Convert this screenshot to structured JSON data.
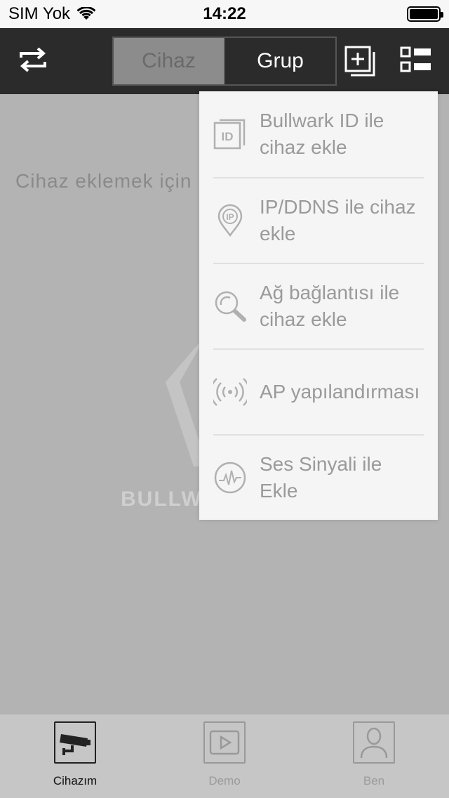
{
  "status_bar": {
    "carrier": "SIM Yok",
    "time": "14:22"
  },
  "nav": {
    "segments": [
      "Cihaz",
      "Grup"
    ],
    "selected": "Grup"
  },
  "main": {
    "hint_text": "Cihaz eklemek için",
    "logo_text": "BULLWARK"
  },
  "dropdown": {
    "items": [
      {
        "label": "Bullwark ID ile cihaz ekle",
        "icon": "id-card-icon"
      },
      {
        "label": "IP/DDNS ile cihaz ekle",
        "icon": "ip-pin-icon"
      },
      {
        "label": "Ağ bağlantısı ile cihaz ekle",
        "icon": "network-search-icon"
      },
      {
        "label": "AP yapılandırması",
        "icon": "wireless-signal-icon"
      },
      {
        "label": "Ses Sinyali ile Ekle",
        "icon": "sound-wave-icon"
      }
    ]
  },
  "tabs": [
    {
      "label": "Cihazım",
      "icon": "camera-icon",
      "active": true
    },
    {
      "label": "Demo",
      "icon": "play-icon",
      "active": false
    },
    {
      "label": "Ben",
      "icon": "user-icon",
      "active": false
    }
  ],
  "colors": {
    "nav_bg": "#2b2b2b",
    "dim_bg": "#b3b3b3",
    "menu_bg": "#f5f5f5",
    "menu_text": "#9a9a9a"
  }
}
